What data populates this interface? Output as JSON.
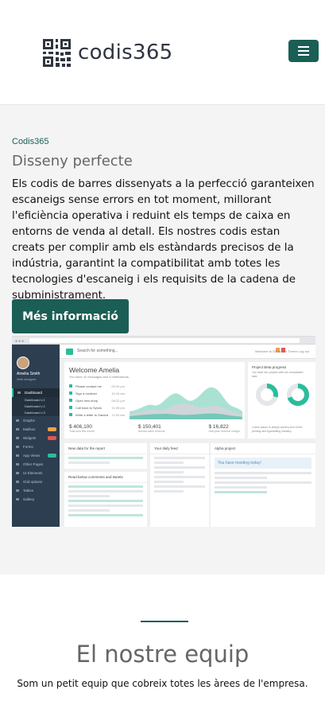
{
  "header": {
    "brand": "codis365",
    "logo_icon": "qr-code-icon",
    "menu_icon": "hamburger-icon",
    "brand_color": "#1b5e55"
  },
  "feature": {
    "eyebrow": "Codis365",
    "title": "Disseny perfecte",
    "body": "Els codis de barres dissenyats a la perfecció garanteixen escaneigs sense errors en tot moment, millorant l'eficiència operativa i reduint els temps de caixa en entorns de venda al detall. Els nostres codis estan creats per complir amb els estàndards precisos de la indústria, garantint la compatibilitat amb totes les tecnologies d'escaneig i els requisits de la cadena de subministrament.",
    "cta_label": "Més informació"
  },
  "mockup": {
    "search": "Search for something...",
    "topbar_right": "Welcome to OS Admin Theme   Log out",
    "user_name": "Amelia Smith",
    "user_role": "Web designer",
    "nav": [
      "Dashboard",
      "Graphs",
      "Mailbox",
      "Widgets",
      "Forms",
      "App Views",
      "Other Pages",
      "UI Elements",
      "Grid options",
      "Tables",
      "Gallery"
    ],
    "subnav": [
      "Dashboard v.1",
      "Dashboard v.2",
      "Dashboard v.3"
    ],
    "welcome": "Welcome Amelia",
    "welcome_sub": "You have 42 messages and 6 notifications.",
    "tasks": [
      {
        "label": "Please contact me",
        "time": "09:00 pm"
      },
      {
        "label": "Sign a contract",
        "time": "10:16 am"
      },
      {
        "label": "Open new shop",
        "time": "08:22 pm"
      },
      {
        "label": "Call back to Sylvia",
        "time": "11:06 pm"
      },
      {
        "label": "Write a letter to Sandra",
        "time": "12:00 am"
      }
    ],
    "stats": [
      {
        "value": "$ 406,100",
        "label": "Total sold this month"
      },
      {
        "value": "$ 150,401",
        "label": "Annual sales revenue"
      },
      {
        "value": "$ 16,822",
        "label": "Half-year revenue margin"
      }
    ],
    "project_title": "Project Beta progress",
    "project_desc": "You have two project with not compleated task.",
    "project_footer": "Lorem ipsum is simply dummy text of the printing and typesetting industry.",
    "donut_labels": [
      "Sales",
      "Monthly"
    ],
    "card1_title": "New data for the report",
    "card1b_title": "Read below comments and tweets",
    "card2_title": "Your daily feed",
    "card3_title": "Alpha project",
    "meeting": "You have meeting today!",
    "accent": "#2bbd9b",
    "sidebar_color": "#2c3e50"
  },
  "team": {
    "title": "El nostre equip",
    "subtitle": "Som un petit equip que cobreix totes les àrees de l'empresa."
  }
}
